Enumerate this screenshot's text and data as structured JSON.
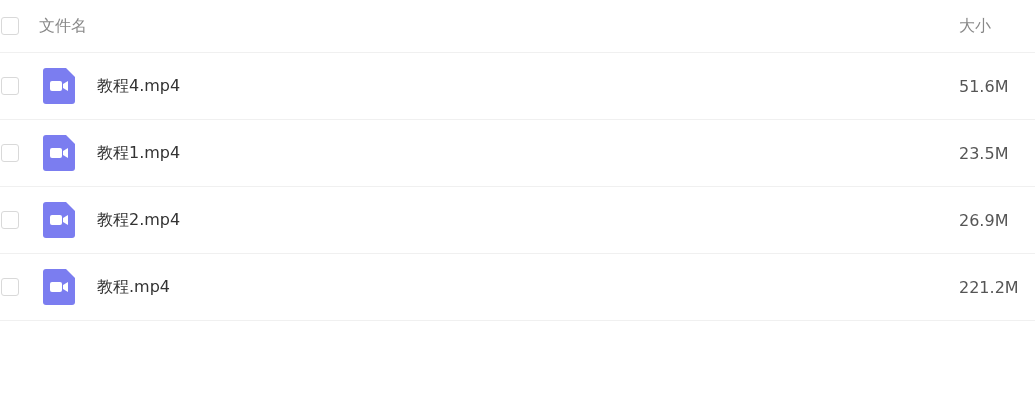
{
  "table": {
    "header": {
      "checked": false,
      "columns": [
        "文件名",
        "大小"
      ]
    },
    "rows": [
      {
        "name": "教程4.mp4",
        "size": "51.6M",
        "checked": false
      },
      {
        "name": "教程1.mp4",
        "size": "23.5M",
        "checked": false
      },
      {
        "name": "教程2.mp4",
        "size": "26.9M",
        "checked": false
      },
      {
        "name": "教程.mp4",
        "size": "221.2M",
        "checked": false
      }
    ]
  }
}
